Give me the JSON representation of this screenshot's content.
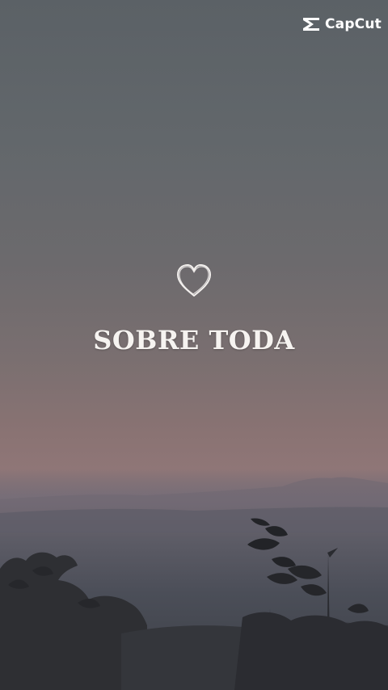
{
  "branding": {
    "logo_label": "CapCut",
    "logo_icon": "capcut-logo-icon"
  },
  "overlay": {
    "icon": "heart-outline-icon",
    "headline": "SOBRE TODA"
  },
  "colors": {
    "text": "#f6f3f0",
    "sky_top": "#5b6166",
    "horizon_glow": "#8f7677",
    "foreground": "#3c3f45"
  }
}
